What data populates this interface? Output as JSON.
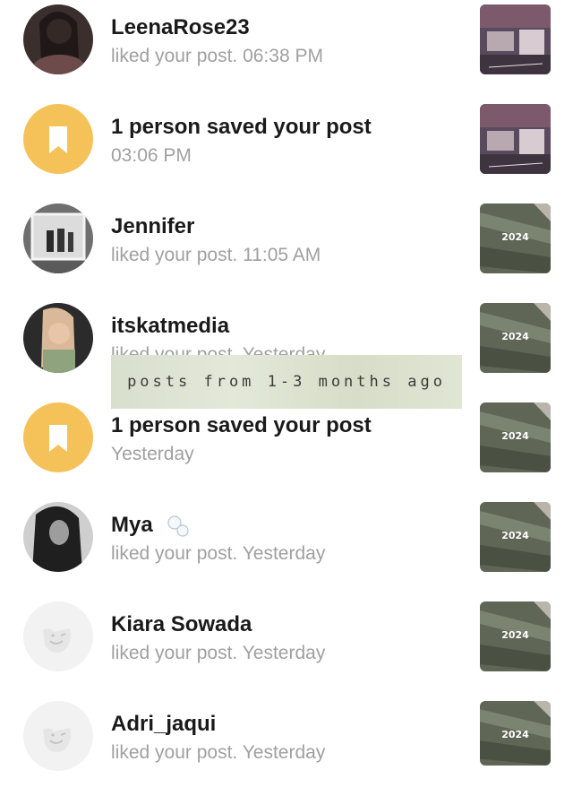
{
  "notifications": [
    {
      "type": "like",
      "name": "LeenaRose23",
      "subtitle": "liked your post. 06:38 PM",
      "avatar": "woman-portrait",
      "thumb": "bedroom-photo"
    },
    {
      "type": "save",
      "name": "1 person saved your post",
      "subtitle": "03:06 PM",
      "avatar": "bookmark-icon",
      "thumb": "bedroom-photo"
    },
    {
      "type": "like",
      "name": "Jennifer",
      "subtitle": "liked your post. 11:05 AM",
      "avatar": "mirror-selfie",
      "thumb": "money-2024"
    },
    {
      "type": "like",
      "name": "itskatmedia",
      "subtitle": "liked your post. Yesterday",
      "avatar": "woman-portrait",
      "thumb": "money-2024"
    },
    {
      "type": "save",
      "name": "1 person saved your post",
      "subtitle": "Yesterday",
      "avatar": "bookmark-icon",
      "thumb": "money-2024"
    },
    {
      "type": "like",
      "name": "Mya",
      "subtitle": "liked your post. Yesterday",
      "avatar": "curly-hair-portrait",
      "thumb": "money-2024",
      "name_emoji": "bubbles-icon"
    },
    {
      "type": "like",
      "name": "Kiara Sowada",
      "subtitle": "liked your post. Yesterday",
      "avatar": "default-avatar",
      "thumb": "money-2024"
    },
    {
      "type": "like",
      "name": "Adri_jaqui",
      "subtitle": "liked your post. Yesterday",
      "avatar": "default-avatar",
      "thumb": "money-2024"
    }
  ],
  "thumb_text": {
    "year": "2024"
  },
  "overlay_banner": {
    "text": "posts from 1-3 months ago"
  },
  "colors": {
    "save_badge": "#f5c25a",
    "subtitle": "#a0a0a0",
    "name": "#1a1a1a"
  }
}
